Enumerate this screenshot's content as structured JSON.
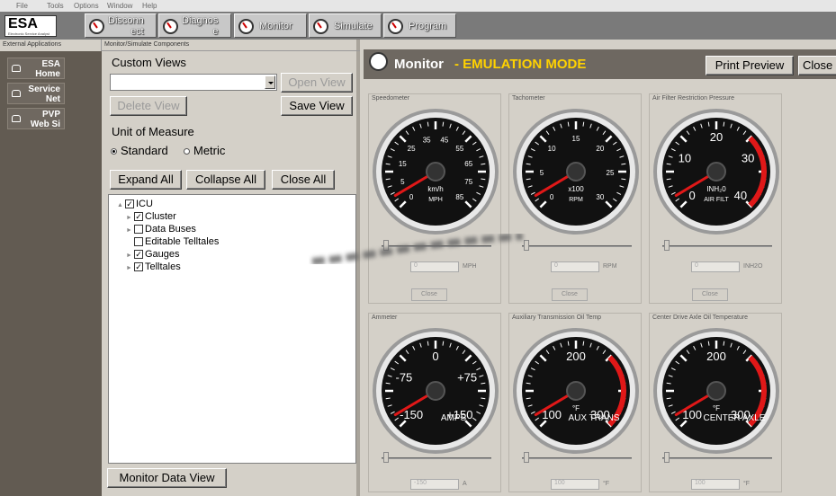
{
  "menu": [
    "File",
    "Tools",
    "Options",
    "Window",
    "Help"
  ],
  "app": {
    "logo": "ESA",
    "logo_subtitle": "Electronic Service Analyst"
  },
  "toolbar": {
    "disconnect": "Disconn\nect",
    "diagnose": "Diagnos\ne",
    "monitor": "Monitor",
    "simulate": "Simulate",
    "program": "Program"
  },
  "external": {
    "header": "External Applications",
    "items": [
      "ESA\nHome",
      "Service\nNet",
      "PVP\nWeb Si"
    ]
  },
  "components": {
    "header": "Monitor/Simulate Components",
    "custom_views": "Custom Views",
    "view_value": "",
    "open_view": "Open View",
    "delete_view": "Delete View",
    "save_view": "Save View",
    "unit_of_measure": "Unit of Measure",
    "standard": "Standard",
    "metric": "Metric",
    "expand_all": "Expand All",
    "collapse_all": "Collapse All",
    "close_all": "Close All",
    "tree": {
      "root": "ICU",
      "children": [
        {
          "label": "Cluster",
          "checked": true
        },
        {
          "label": "Data Buses",
          "checked": false
        },
        {
          "label": "Editable Telltales",
          "checked": false
        },
        {
          "label": "Gauges",
          "checked": true
        },
        {
          "label": "Telltales",
          "checked": true
        }
      ]
    },
    "monitor_data_view": "Monitor Data View"
  },
  "monitor": {
    "title": "Monitor",
    "mode": "- EMULATION MODE",
    "print_preview": "Print Preview",
    "close": "Close"
  },
  "gauges": [
    {
      "title": "Speedometer",
      "labels": [
        "0",
        "5",
        "15",
        "25",
        "35",
        "45",
        "55",
        "65",
        "75",
        "85"
      ],
      "center1": "km/h",
      "center2": "MPH",
      "value": "0",
      "unit": "MPH",
      "close": "Close"
    },
    {
      "title": "Tachometer",
      "labels": [
        "0",
        "5",
        "10",
        "15",
        "20",
        "25",
        "30"
      ],
      "center1": "x100",
      "center2": "RPM",
      "value": "0",
      "unit": "RPM",
      "close": "Close"
    },
    {
      "title": "Air Filter Restriction Pressure",
      "labels": [
        "0",
        "10",
        "20",
        "30",
        "40"
      ],
      "center1": "INH₂0",
      "center2": "AIR FILT",
      "value": "0",
      "unit": "INH2O",
      "close": "Close"
    },
    {
      "title": "Ammeter",
      "labels": [
        "-150",
        "-75",
        "0",
        "+75",
        "+150"
      ],
      "center1": "",
      "center2": "AMPS",
      "value": "-150",
      "unit": "A",
      "close": ""
    },
    {
      "title": "Auxiliary Transmission Oil Temp",
      "labels": [
        "100",
        "200",
        "300"
      ],
      "center1": "°F",
      "center2": "AUX TRANS",
      "value": "100",
      "unit": "°F",
      "close": ""
    },
    {
      "title": "Center Drive Axle Oil Temperature",
      "labels": [
        "100",
        "200",
        "300"
      ],
      "center1": "°F",
      "center2": "CENTER AXLE",
      "value": "100",
      "unit": "°F",
      "close": ""
    }
  ]
}
